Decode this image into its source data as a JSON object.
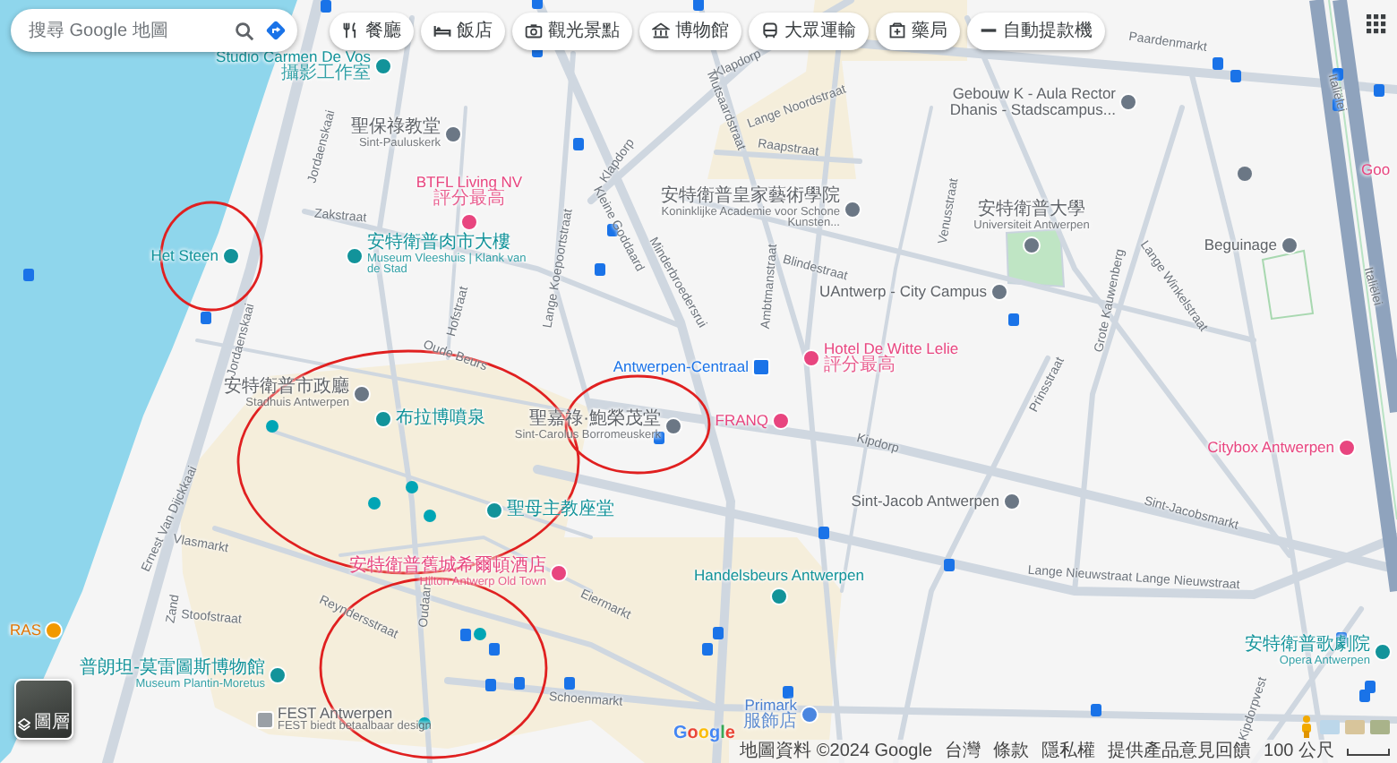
{
  "search": {
    "placeholder": "搜尋 Google 地圖"
  },
  "chips": [
    {
      "label": "餐廳",
      "kind": "restaurant"
    },
    {
      "label": "飯店",
      "kind": "hotel"
    },
    {
      "label": "觀光景點",
      "kind": "attraction"
    },
    {
      "label": "博物館",
      "kind": "museum"
    },
    {
      "label": "大眾運輸",
      "kind": "transit"
    },
    {
      "label": "藥局",
      "kind": "pharmacy"
    },
    {
      "label": "自動提款機",
      "kind": "atm"
    }
  ],
  "places": [
    {
      "name": "Studio Carmen De Vos",
      "subtitle": "攝影工作室",
      "kind": "attraction"
    },
    {
      "name": "聖保祿教堂",
      "subtitle": "Sint-Pauluskerk",
      "kind": "place"
    },
    {
      "name": "BTFL Living NV",
      "subtitle": "評分最高",
      "kind": "hotel"
    },
    {
      "name": "Het Steen",
      "kind": "attraction"
    },
    {
      "name": "安特衛普肉市大樓",
      "subtitle": "Museum Vleeshuis | Klank van de Stad",
      "kind": "attraction"
    },
    {
      "name": "安特衛普皇家藝術學院",
      "subtitle": "Koninklijke Academie voor Schone Kunsten...",
      "kind": "place"
    },
    {
      "name": "Gebouw K - Aula Rector Dhanis - Stadscampus...",
      "kind": "place"
    },
    {
      "name": "安特衛普大學",
      "subtitle": "Universiteit Antwerpen",
      "kind": "place"
    },
    {
      "name": "Beguinage",
      "kind": "place"
    },
    {
      "name": "UAntwerp - City Campus",
      "kind": "place"
    },
    {
      "name": "Antwerpen-Centraal",
      "kind": "transit"
    },
    {
      "name": "Hotel De Witte Lelie",
      "subtitle": "評分最高",
      "kind": "hotel"
    },
    {
      "name": "FRANQ",
      "kind": "hotel"
    },
    {
      "name": "Citybox Antwerpen",
      "kind": "hotel"
    },
    {
      "name": "Sint-Jacob Antwerpen",
      "kind": "place"
    },
    {
      "name": "安特衛普市政廳",
      "subtitle": "Stadhuis Antwerpen",
      "kind": "place"
    },
    {
      "name": "布拉博噴泉",
      "kind": "attraction"
    },
    {
      "name": "聖嘉祿·鮑榮茂堂",
      "subtitle": "Sint-Carolus Borromeuskerk",
      "kind": "place"
    },
    {
      "name": "聖母主教座堂",
      "kind": "attraction"
    },
    {
      "name": "安特衛普舊城希爾頓酒店",
      "subtitle": "Hilton Antwerp Old Town",
      "kind": "hotel"
    },
    {
      "name": "Handelsbeurs Antwerpen",
      "kind": "attraction"
    },
    {
      "name": "RAS",
      "kind": "restaurant"
    },
    {
      "name": "普朗坦-莫雷圖斯博物館",
      "subtitle": "Museum Plantin-Moretus",
      "kind": "attraction"
    },
    {
      "name": "FEST Antwerpen",
      "subtitle": "FEST biedt betaalbaar design",
      "kind": "store"
    },
    {
      "name": "Primark",
      "subtitle": "服飾店",
      "kind": "shop"
    },
    {
      "name": "安特衛普歌劇院",
      "subtitle": "Opera Antwerpen",
      "kind": "attraction"
    },
    {
      "name": "Goo",
      "kind": "hotel"
    }
  ],
  "streets": [
    "Paardenmarkt",
    "Klapdorp",
    "Mutsaardstraat",
    "Lange Noordstraat",
    "Raapstraat",
    "Klapdorp",
    "Zakstraat",
    "Jordaenskaai",
    "Kleine Goddaard",
    "Lange Koepoortstraat",
    "Minderbroedersrui",
    "Ambtmanstraat",
    "Blindestraat",
    "Venusstraat",
    "Grote Kauwenberg",
    "Lange Winkelstraat",
    "Italiëlei",
    "Kipdorp",
    "Sint-Jacobsmarkt",
    "Lange Nieuwstraat Lange Nieuwstraat",
    "Vlasmarkt",
    "Reyndersstraat",
    "Stoofstraat",
    "Ernest Van Dijckkaai",
    "Schoenmarkt",
    "Eiermarkt",
    "Kipdorpvest",
    "Hofstraat",
    "Oude Beurs",
    "Prinsstraat",
    "Oudaan",
    "Zand",
    "Italiëlei",
    "Jordaenskaai"
  ],
  "layers_button": {
    "label": "圖層"
  },
  "logo": "Google",
  "footer": {
    "attribution": "地圖資料 ©2024 Google",
    "links": [
      "台灣",
      "條款",
      "隱私權",
      "提供產品意見回饋"
    ],
    "scale": "100 公尺"
  }
}
